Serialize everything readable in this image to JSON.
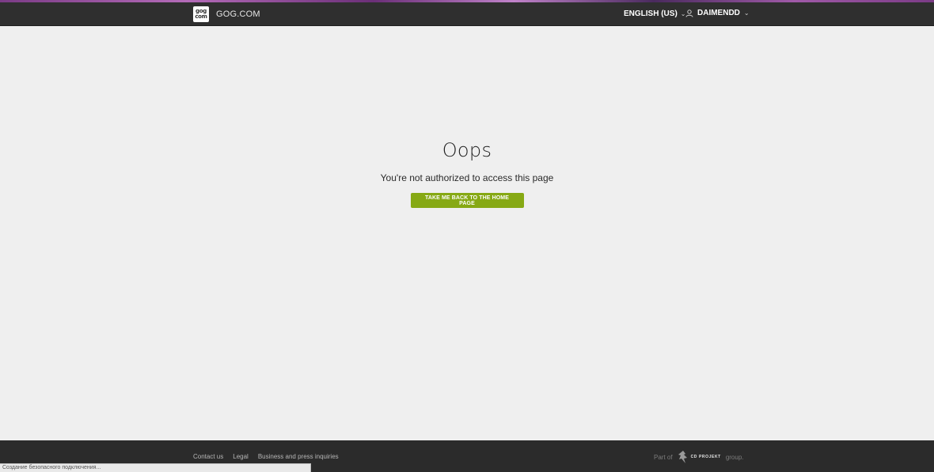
{
  "header": {
    "logo_top": "gog",
    "logo_bottom": "com",
    "brand": "GOG.COM",
    "language": "ENGLISH (US)",
    "username": "DAIMENDD"
  },
  "error": {
    "title": "Oops",
    "message": "You're not authorized to access this page",
    "button_label": "TAKE ME BACK TO THE HOME PAGE",
    "button_color": "#86a914"
  },
  "footer": {
    "links": [
      "Contact us",
      "Legal",
      "Business and press inquiries"
    ],
    "part_of": "Part of",
    "company": "CD PROJEKT",
    "group": "group."
  },
  "status_bar": "Создание безопасного подключения..."
}
